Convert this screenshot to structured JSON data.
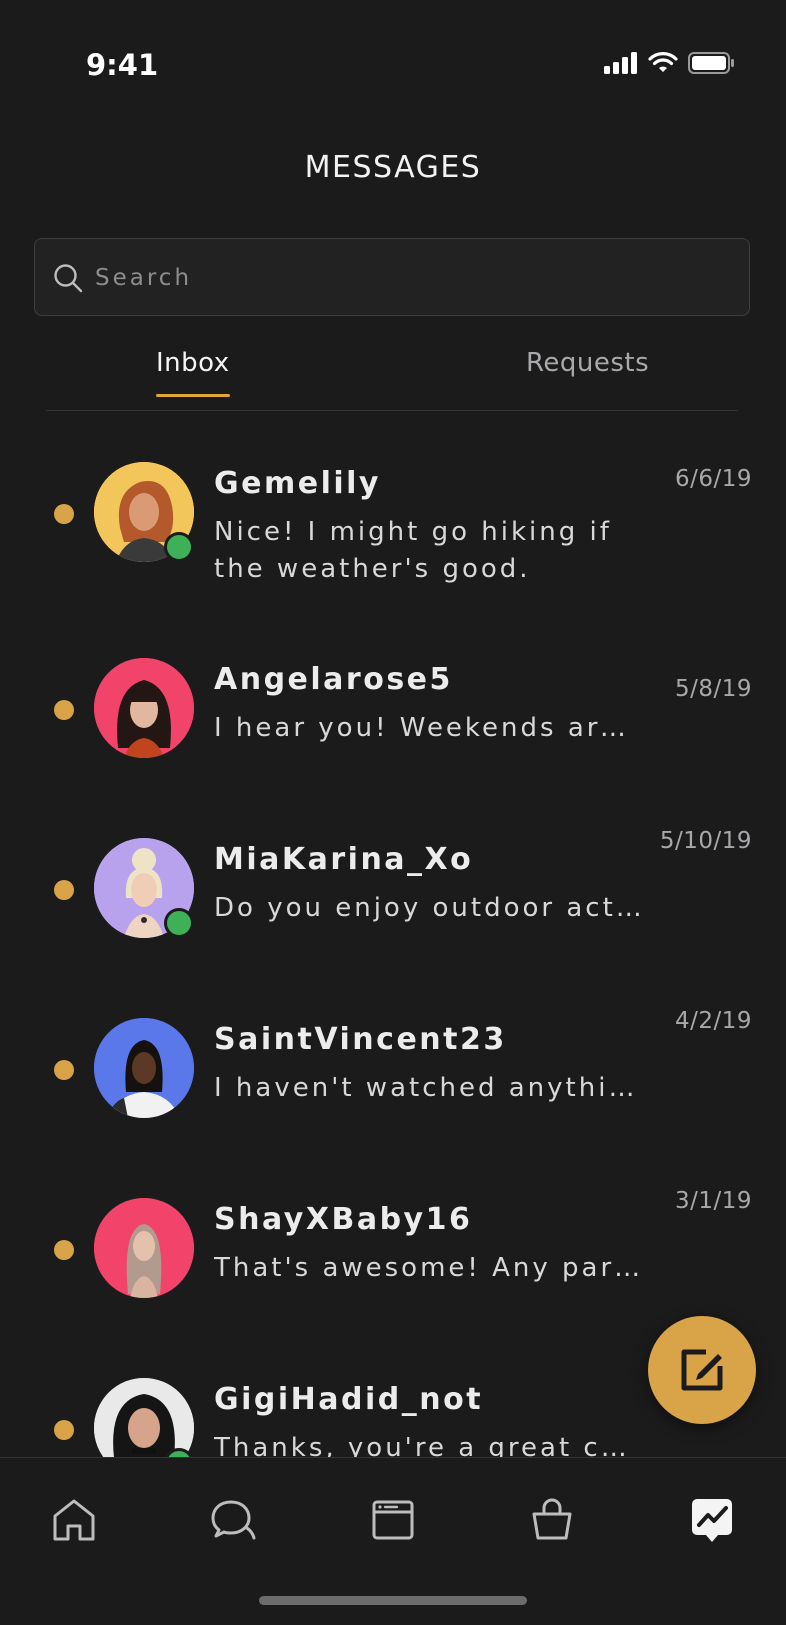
{
  "status_bar": {
    "time": "9:41"
  },
  "header": {
    "title": "MESSAGES"
  },
  "search": {
    "placeholder": "Search"
  },
  "tabs": [
    {
      "label": "Inbox",
      "active": true
    },
    {
      "label": "Requests",
      "active": false
    }
  ],
  "conversations": [
    {
      "name": "Gemelily",
      "preview": "Nice! I might go hiking if the weather's good.",
      "date": "6/6/19",
      "unread": true,
      "online": true,
      "avatar_bg": "#f2c65b"
    },
    {
      "name": "Angelarose5",
      "preview": "I hear you! Weekends are…",
      "date": "5/8/19",
      "unread": true,
      "online": false,
      "avatar_bg": "#f2436a"
    },
    {
      "name": "MiaKarina_Xo",
      "preview": "Do you enjoy outdoor act…",
      "date": "5/10/19",
      "unread": true,
      "online": true,
      "avatar_bg": "#b8a2ee"
    },
    {
      "name": "SaintVincent23",
      "preview": "I haven't watched anythin…",
      "date": "4/2/19",
      "unread": true,
      "online": false,
      "avatar_bg": "#5a78ea"
    },
    {
      "name": "ShayXBaby16",
      "preview": "That's awesome! Any par…",
      "date": "3/1/19",
      "unread": true,
      "online": false,
      "avatar_bg": "#f2436a"
    },
    {
      "name": "GigiHadid_not",
      "preview": "Thanks, you're a great ch…",
      "date": "",
      "unread": true,
      "online": true,
      "avatar_bg": "#e9e9e9"
    }
  ],
  "bottom_nav": [
    {
      "icon": "home-icon"
    },
    {
      "icon": "chat-icon"
    },
    {
      "icon": "feed-icon"
    },
    {
      "icon": "shop-bag-icon"
    },
    {
      "icon": "messages-icon",
      "active": true
    }
  ],
  "colors": {
    "accent": "#d9a448",
    "online": "#3db058",
    "background": "#1b1b1c"
  }
}
